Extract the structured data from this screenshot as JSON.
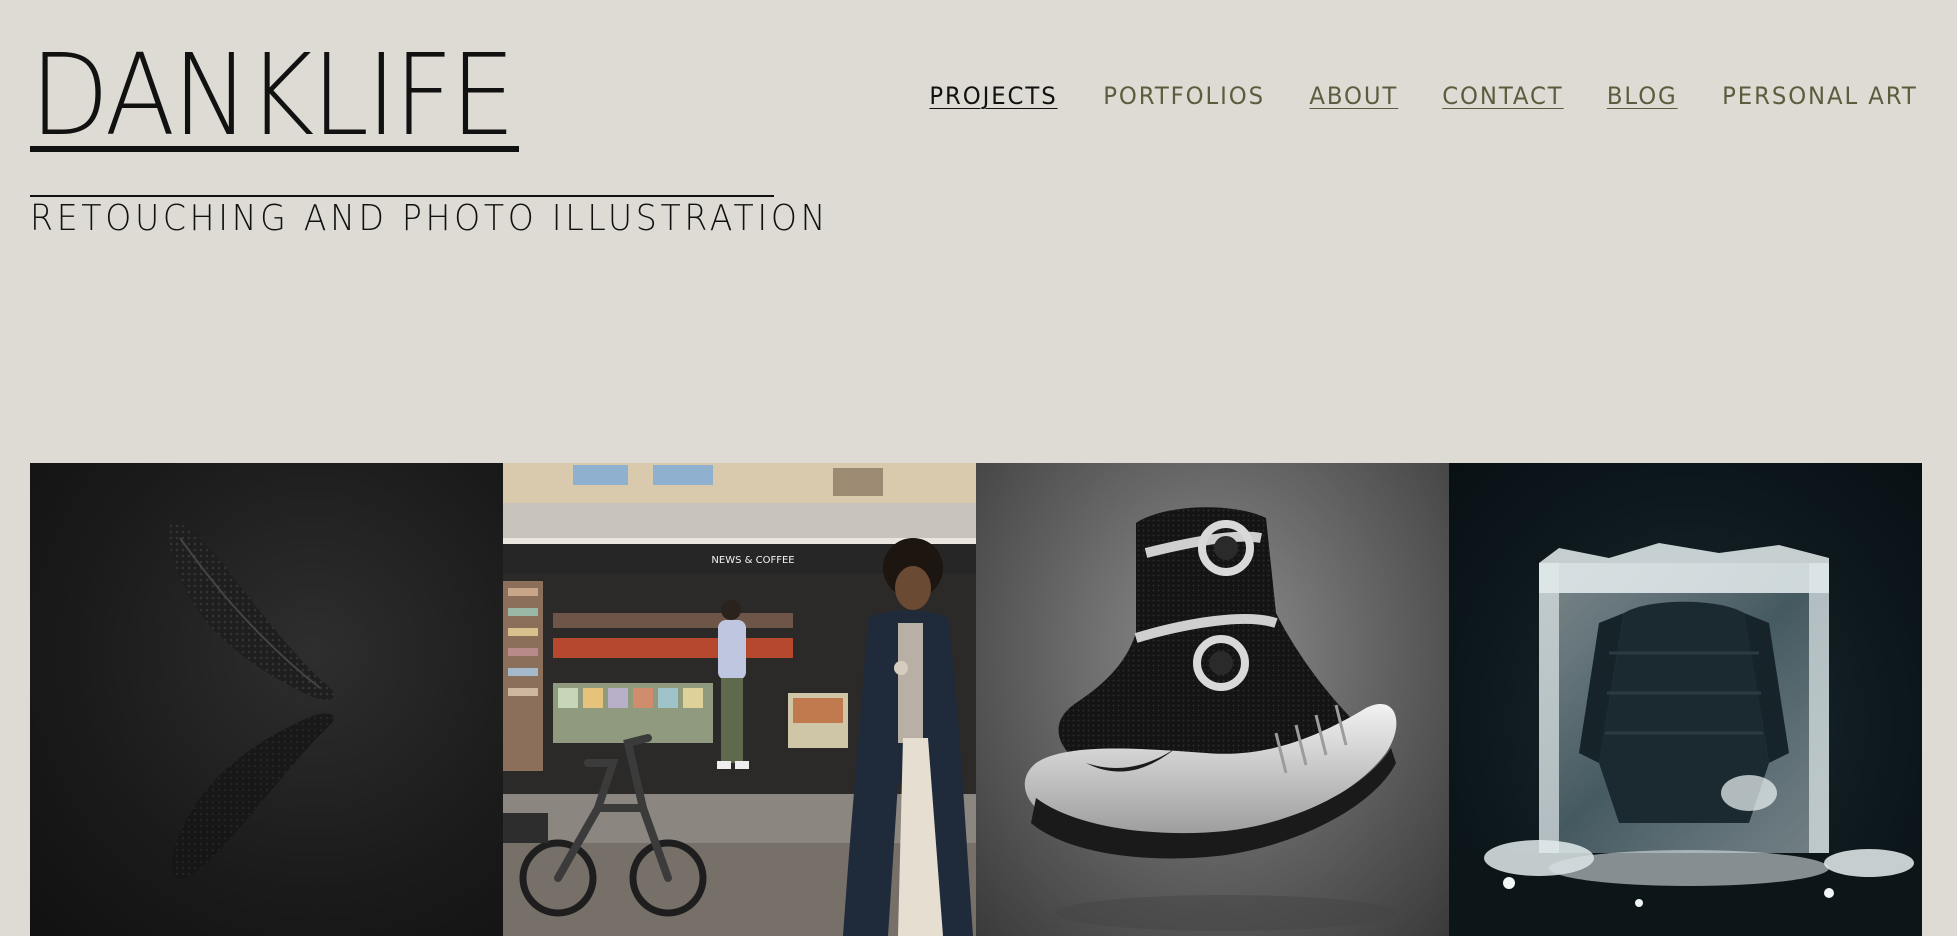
{
  "header": {
    "logo_text": "DANKLIFE",
    "tagline": "RETOUCHING AND PHOTO ILLUSTRATION"
  },
  "nav": {
    "items": [
      {
        "label": "PROJECTS",
        "color": "#111111",
        "underline": true
      },
      {
        "label": "PORTFOLIOS",
        "color": "#5e5b3e",
        "underline": false
      },
      {
        "label": "ABOUT",
        "color": "#5e5b3e",
        "underline": true
      },
      {
        "label": "CONTACT",
        "color": "#5e5b3e",
        "underline": true
      },
      {
        "label": "BLOG",
        "color": "#5e5b3e",
        "underline": true
      },
      {
        "label": "PERSONAL ART",
        "color": "#5e5b3e",
        "underline": false
      }
    ]
  },
  "gallery": {
    "tiles": [
      {
        "icon": "black-shoe-reflection-image"
      },
      {
        "icon": "newsstand-street-scene-image",
        "sign_text": "NEWS & COFFEE"
      },
      {
        "icon": "nike-sneaker-image"
      },
      {
        "icon": "jacket-in-ice-block-image"
      }
    ]
  },
  "colors": {
    "background": "#dddbd3",
    "nav_active": "#111111",
    "nav_inactive": "#5e5b3e"
  }
}
